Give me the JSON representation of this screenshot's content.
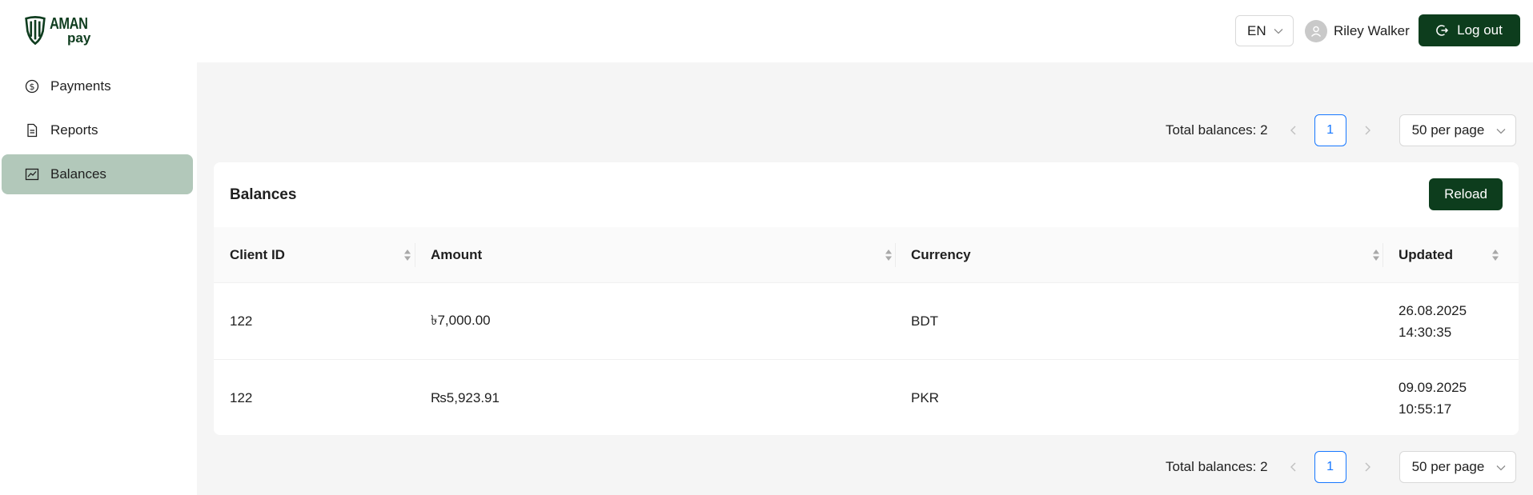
{
  "brand": {
    "line1": "AMAN",
    "line2": "pay",
    "color": "#0f3d1f"
  },
  "header": {
    "language": "EN",
    "user_name": "Riley Walker",
    "logout_label": "Log out",
    "icons": {
      "user": "user-avatar-icon",
      "logout": "logout-icon",
      "chevron": "chevron-down-icon"
    }
  },
  "sidebar": {
    "items": [
      {
        "label": "Payments",
        "icon": "dollar-circle-icon",
        "active": false
      },
      {
        "label": "Reports",
        "icon": "file-text-icon",
        "active": false
      },
      {
        "label": "Balances",
        "icon": "line-chart-icon",
        "active": true
      }
    ]
  },
  "pagination": {
    "total_text": "Total balances: 2",
    "current_page": "1",
    "page_size": "50 per page"
  },
  "balances": {
    "title": "Balances",
    "reload_label": "Reload",
    "columns": [
      "Client ID",
      "Amount",
      "Currency",
      "Updated"
    ],
    "rows": [
      {
        "client_id": "122",
        "amount": "৳7,000.00",
        "currency": "BDT",
        "updated_date": "26.08.2025",
        "updated_time": "14:30:35"
      },
      {
        "client_id": "122",
        "amount": "₨5,923.91",
        "currency": "PKR",
        "updated_date": "09.09.2025",
        "updated_time": "10:55:17"
      }
    ]
  },
  "colors": {
    "primary": "#0d3d1d",
    "active_nav": "#b2c8ba",
    "link_blue": "#1677ff",
    "main_bg": "#f5f5f5"
  }
}
